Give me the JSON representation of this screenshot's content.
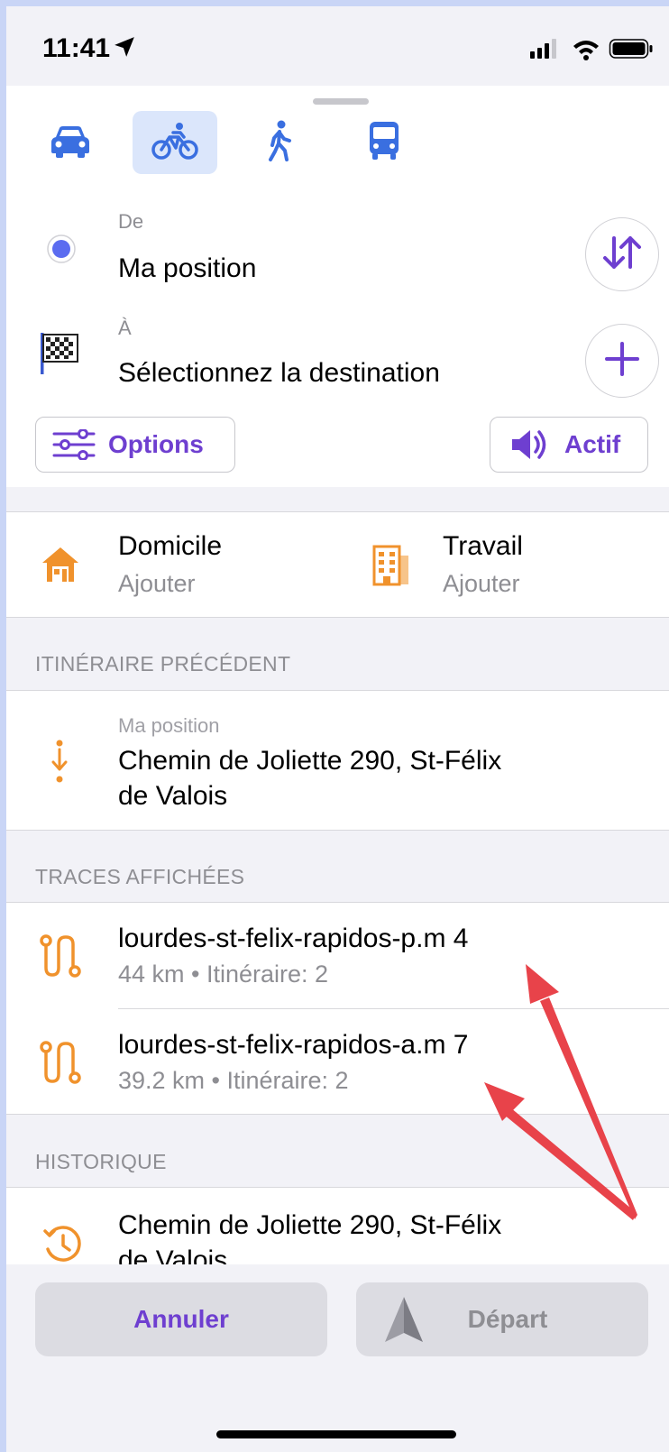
{
  "status_bar": {
    "time": "11:41"
  },
  "transport_modes": [
    {
      "name": "car",
      "active": false
    },
    {
      "name": "bicycle",
      "active": true
    },
    {
      "name": "walk",
      "active": false
    },
    {
      "name": "bus",
      "active": false
    }
  ],
  "route": {
    "from_label": "De",
    "from_value": "Ma position",
    "to_label": "À",
    "to_value": "Sélectionnez la destination"
  },
  "buttons": {
    "options": "Options",
    "sound": "Actif"
  },
  "favorites": {
    "home_title": "Domicile",
    "home_action": "Ajouter",
    "work_title": "Travail",
    "work_action": "Ajouter"
  },
  "previous_route": {
    "header": "ITINÉRAIRE PRÉCÉDENT",
    "from": "Ma position",
    "to_line1": "Chemin de Joliette 290, St-Félix",
    "to_line2": "de Valois"
  },
  "tracks": {
    "header": "TRACES AFFICHÉES",
    "items": [
      {
        "name": "lourdes-st-felix-rapidos-p.m 4",
        "detail": "44 km • Itinéraire: 2"
      },
      {
        "name": "lourdes-st-felix-rapidos-a.m 7",
        "detail": "39.2 km • Itinéraire: 2"
      }
    ]
  },
  "history": {
    "header": "HISTORIQUE",
    "line1": "Chemin de Joliette 290, St-Félix",
    "line2": "de Valois"
  },
  "bottom": {
    "cancel": "Annuler",
    "start": "Départ"
  },
  "colors": {
    "accent_purple": "#6e3fd0",
    "mode_blue": "#3a6fe0",
    "orange": "#f0922c",
    "annotation_red": "#e8434a"
  }
}
